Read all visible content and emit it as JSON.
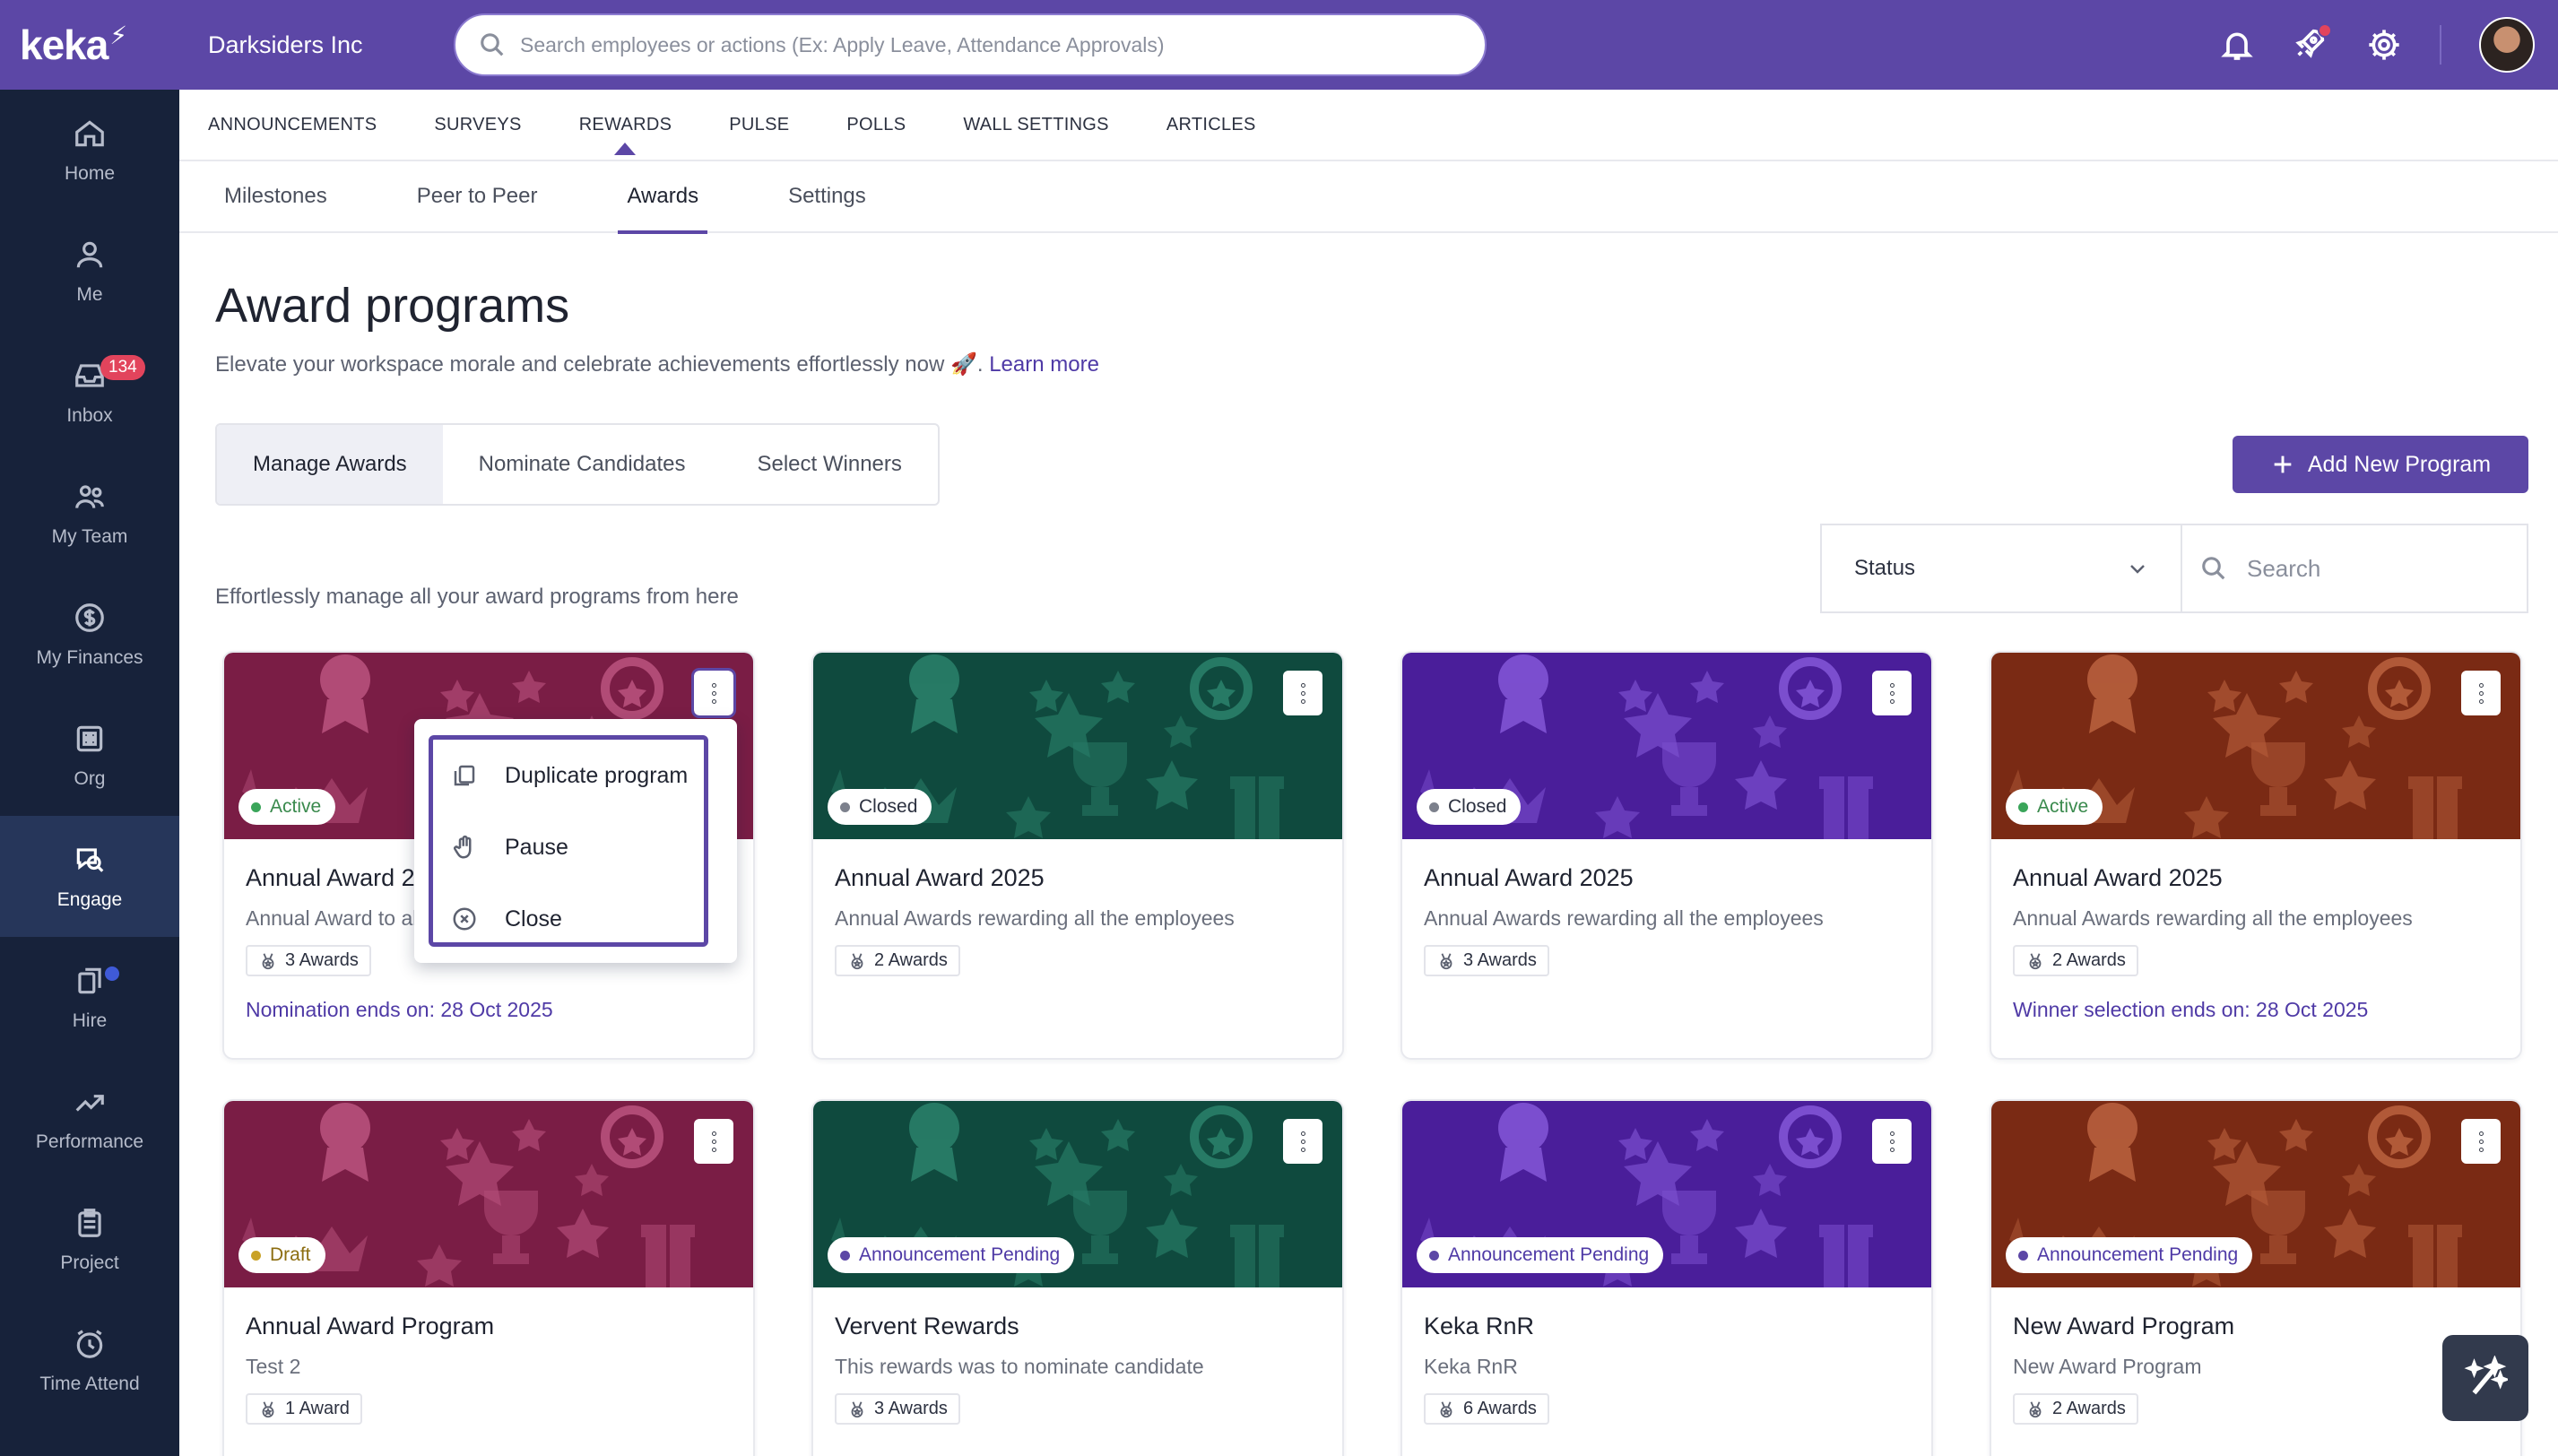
{
  "brand": {
    "logo_text": "keka"
  },
  "sidebar": {
    "items": [
      {
        "label": "Home",
        "icon": "home-icon"
      },
      {
        "label": "Me",
        "icon": "user-icon"
      },
      {
        "label": "Inbox",
        "icon": "inbox-icon",
        "badge": "134"
      },
      {
        "label": "My Team",
        "icon": "team-icon"
      },
      {
        "label": "My Finances",
        "icon": "dollar-icon"
      },
      {
        "label": "Org",
        "icon": "org-icon"
      },
      {
        "label": "Engage",
        "icon": "engage-icon",
        "active": true
      },
      {
        "label": "Hire",
        "icon": "hire-icon"
      },
      {
        "label": "Performance",
        "icon": "trend-icon"
      },
      {
        "label": "Project",
        "icon": "clipboard-icon"
      },
      {
        "label": "Time Attend",
        "icon": "alarm-icon"
      }
    ]
  },
  "header": {
    "company": "Darksiders Inc",
    "search_placeholder": "Search employees or actions (Ex: Apply Leave, Attendance Approvals)"
  },
  "tabs_primary": [
    "ANNOUNCEMENTS",
    "SURVEYS",
    "REWARDS",
    "PULSE",
    "POLLS",
    "WALL SETTINGS",
    "ARTICLES"
  ],
  "tabs_primary_active": "REWARDS",
  "tabs_secondary": [
    "Milestones",
    "Peer to Peer",
    "Awards",
    "Settings"
  ],
  "tabs_secondary_active": "Awards",
  "main": {
    "title": "Award programs",
    "subtitle": "Elevate your workspace morale and celebrate achievements effortlessly now 🚀.",
    "learn_more": "Learn more",
    "segments": [
      "Manage Awards",
      "Nominate Candidates",
      "Select Winners"
    ],
    "add_button": "Add New Program",
    "status_label": "Status",
    "search_placeholder": "Search",
    "section_subtitle": "Effortlessly manage all your award programs from here"
  },
  "cards": [
    {
      "status": "Active",
      "title": "Annual Award 2025",
      "desc": "Annual Award to all the employees",
      "awards": "3 Awards",
      "footer": "Nomination ends on: 28 Oct 2025",
      "theme": "maroon"
    },
    {
      "status": "Closed",
      "title": "Annual Award 2025",
      "desc": "Annual Awards rewarding all the employees",
      "awards": "2 Awards",
      "footer": "",
      "theme": "green"
    },
    {
      "status": "Closed",
      "title": "Annual Award 2025",
      "desc": "Annual Awards rewarding all the employees",
      "awards": "3 Awards",
      "footer": "",
      "theme": "purple"
    },
    {
      "status": "Active",
      "title": "Annual Award 2025",
      "desc": "Annual Awards rewarding all the employees",
      "awards": "2 Awards",
      "footer": "Winner selection ends on: 28 Oct 2025",
      "theme": "rust"
    },
    {
      "status": "Draft",
      "title": "Annual Award Program",
      "desc": "Test 2",
      "awards": "1 Award",
      "footer": "",
      "theme": "maroon"
    },
    {
      "status": "Announcement Pending",
      "title": "Vervent Rewards",
      "desc": "This rewards was to nominate candidate",
      "awards": "3 Awards",
      "footer": "",
      "theme": "green"
    },
    {
      "status": "Announcement Pending",
      "title": "Keka RnR",
      "desc": "Keka RnR",
      "awards": "6 Awards",
      "footer": "",
      "theme": "purple"
    },
    {
      "status": "Announcement Pending",
      "title": "New Award Program",
      "desc": "New Award Program",
      "awards": "2 Awards",
      "footer": "",
      "theme": "rust"
    }
  ],
  "menu": {
    "items": [
      {
        "label": "Duplicate program",
        "icon": "copy-icon"
      },
      {
        "label": "Pause",
        "icon": "hand-icon"
      },
      {
        "label": "Close",
        "icon": "close-circle-icon"
      }
    ]
  },
  "colors": {
    "brand": "#5c47a6",
    "sidebar": "#17223a",
    "maroon": "#7a1d45",
    "green": "#0f4a3e",
    "purple": "#4a1e9a",
    "rust": "#7a2a14",
    "status_active": "#3aa55a",
    "status_closed": "#7c808c",
    "status_draft": "#c9a227",
    "status_pending": "#5c47a6"
  }
}
